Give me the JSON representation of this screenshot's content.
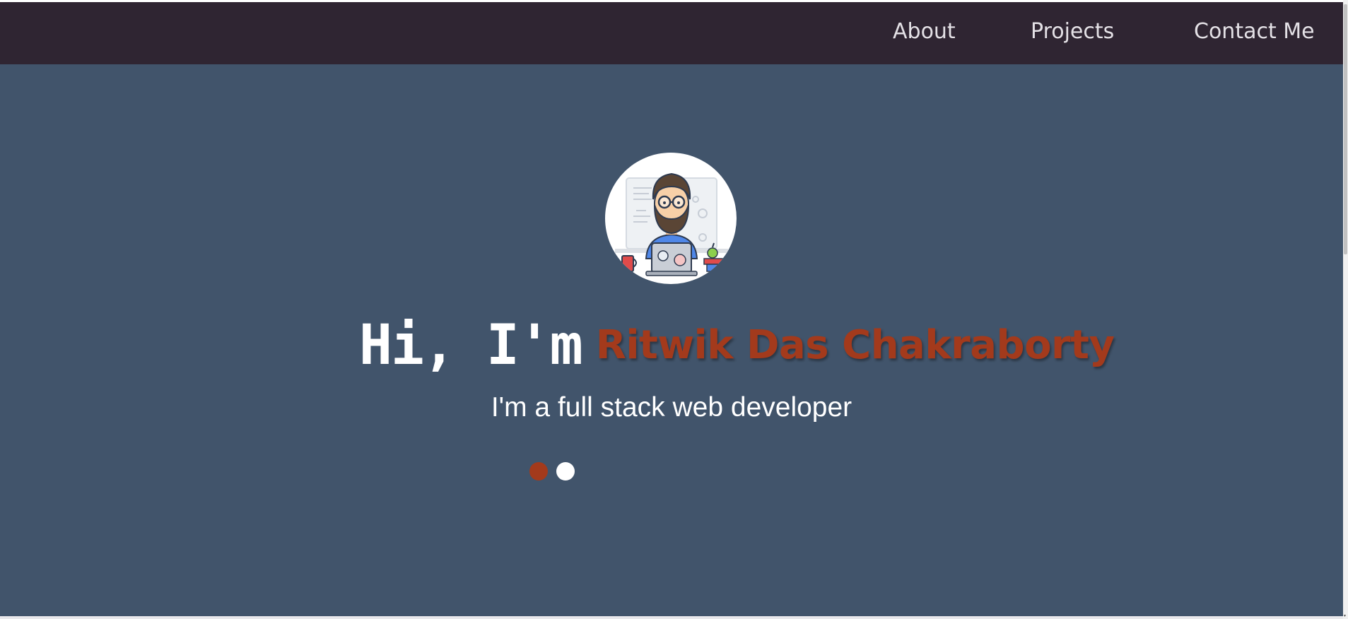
{
  "nav": {
    "links": [
      {
        "label": "About"
      },
      {
        "label": "Projects"
      },
      {
        "label": "Contact Me"
      }
    ]
  },
  "hero": {
    "greeting": "Hi, I'm",
    "name": "Ritwik Das Chakraborty",
    "tagline": "I'm a full stack web developer",
    "avatar_icon": "developer-avatar-icon",
    "carousel": {
      "slide_count": 2,
      "active_index": 0
    }
  },
  "colors": {
    "navbar": "#2f2532",
    "hero_background": "#41546b",
    "accent": "#a33a1c",
    "text": "#ffffff"
  }
}
